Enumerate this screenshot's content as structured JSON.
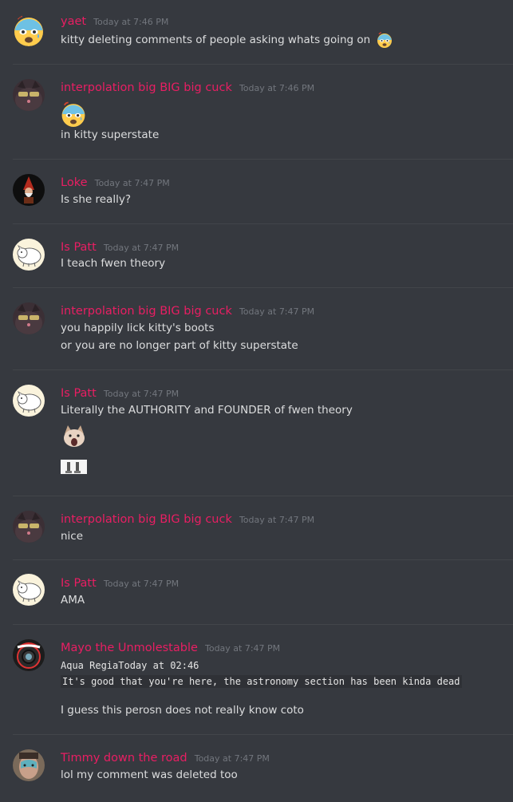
{
  "colors": {
    "background": "#36393f",
    "author": "#e91e63",
    "timestamp": "#72767d",
    "text": "#dcddde"
  },
  "messages": [
    {
      "author": "yaet",
      "time": "Today at 7:46 PM",
      "avatar_icon": "cold-sweat-emoji-icon",
      "lines": [
        "kitty deleting comments of people asking whats going on"
      ],
      "inline_emoji": "cold-sweat-emoji-icon"
    },
    {
      "author": "interpolation big BIG big cuck",
      "time": "Today at 7:46 PM",
      "avatar_icon": "cat-with-sunglasses-avatar",
      "emoji_line": "cold-sweat-emoji-icon",
      "lines": [
        "in kitty superstate"
      ]
    },
    {
      "author": "Loke",
      "time": "Today at 7:47 PM",
      "avatar_icon": "gnome-figure-avatar",
      "lines": [
        "Is she really?"
      ]
    },
    {
      "author": "Is Patt",
      "time": "Today at 7:47 PM",
      "avatar_icon": "white-dog-sketch-avatar",
      "lines": [
        "I teach fwen theory"
      ]
    },
    {
      "author": "interpolation big BIG big cuck",
      "time": "Today at 7:47 PM",
      "avatar_icon": "cat-with-sunglasses-avatar",
      "lines": [
        "you happily lick kitty's boots",
        "or you are no longer part of kitty superstate"
      ]
    },
    {
      "author": "Is Patt",
      "time": "Today at 7:47 PM",
      "avatar_icon": "white-dog-sketch-avatar",
      "lines": [
        "Literally the AUTHORITY and FOUNDER of fwen theory"
      ],
      "attachments": [
        "pop-cat-emoji-icon",
        "small-image-attachment"
      ]
    },
    {
      "author": "interpolation big BIG big cuck",
      "time": "Today at 7:47 PM",
      "avatar_icon": "cat-with-sunglasses-avatar",
      "lines": [
        "nice"
      ]
    },
    {
      "author": "Is Patt",
      "time": "Today at 7:47 PM",
      "avatar_icon": "white-dog-sketch-avatar",
      "lines": [
        "AMA"
      ]
    },
    {
      "author": "Mayo the Unmolestable",
      "time": "Today at 7:47 PM",
      "avatar_icon": "santa-hat-camera-avatar",
      "code_lines": [
        "Aqua RegiaToday at 02:46",
        "It's good that you're here, the astronomy section has been kinda dead"
      ],
      "lines": [
        "I guess this perosn does not really know coto"
      ]
    },
    {
      "author": "Timmy down the road",
      "time": "Today at 7:47 PM",
      "avatar_icon": "face-with-paint-avatar",
      "lines": [
        "lol my comment was deleted too"
      ]
    }
  ]
}
